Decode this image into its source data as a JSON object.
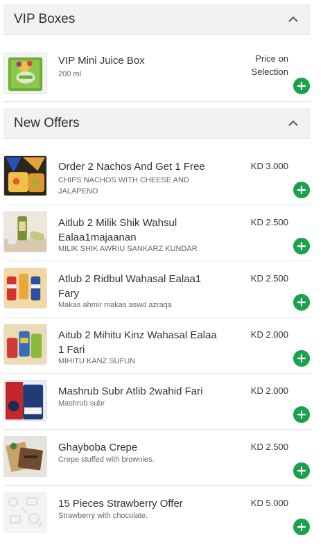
{
  "sections": [
    {
      "title": "VIP Boxes",
      "collapse_icon": "chevron-up-icon",
      "items": [
        {
          "name": "VIP Mini Juice Box",
          "desc": "200 ml",
          "price_line1": "Price on",
          "price_line2": "Selection",
          "image": "juice-box-image"
        }
      ]
    },
    {
      "title": "New Offers",
      "collapse_icon": "chevron-up-icon",
      "items": [
        {
          "name": "Order 2 Nachos And Get 1 Free",
          "desc": "CHIPS NACHOS WITH CHEESE AND JALAPENO",
          "price": "KD 3.000",
          "image": "nachos-image"
        },
        {
          "name": "Aitlub 2 Milik Shik Wahsul Ealaa1majaanan",
          "desc": "MILIK SHIK AWRIU SANKARZ KUNDAR",
          "price": "KD 2.500",
          "image": "milkshake-cans-image"
        },
        {
          "name": "Atlub 2 Ridbul Wahasal Ealaa1 Fary",
          "desc": "Makas ahmir makas aswd azraqa",
          "price": "KD 2.500",
          "image": "redbull-cans-image"
        },
        {
          "name": "Aitub 2 Mihitu Kinz Wahasal Ealaa 1 Fari",
          "desc": "MIHITU KANZ SUFUN",
          "price": "KD 2.000",
          "image": "mojito-cans-image"
        },
        {
          "name": "Mashrub Subr Atlib 2wahid Fari",
          "desc": "Mashrub subr",
          "price": "KD 2.000",
          "image": "sobr-drink-image"
        },
        {
          "name": "Ghayboba Crepe",
          "desc": "Crepe stuffed with brownies.",
          "price": "KD 2.500",
          "image": "crepe-image"
        },
        {
          "name": "15 Pieces Strawberry Offer",
          "desc": "Strawberry with chocolate.",
          "price": "KD 5.000",
          "image": "placeholder-image"
        }
      ]
    }
  ],
  "add_icon": "plus-icon",
  "colors": {
    "accent": "#1aa24a",
    "header_bg": "#f2f2f2"
  }
}
